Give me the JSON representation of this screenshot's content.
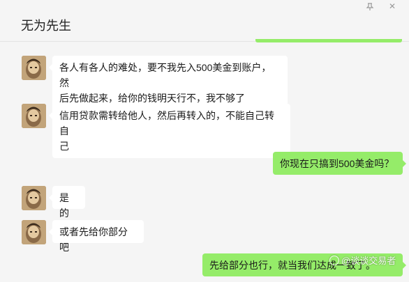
{
  "header": {
    "title": "无为先生"
  },
  "messages": [
    {
      "side": "left",
      "text": "各人有各人的难处，要不我先入500美金到账户，然\n后先做起来，给你的钱明天行不，我不够了"
    },
    {
      "side": "left",
      "text": "信用贷款需转给他人，然后再转入的，不能自己转自\n己"
    },
    {
      "side": "right",
      "text": "你现在只搞到500美金吗？"
    },
    {
      "side": "left",
      "text": "是的"
    },
    {
      "side": "left",
      "text": "或者先给你部分吧"
    },
    {
      "side": "right",
      "text": "先给部分也行，就当我们达成一致了。"
    }
  ],
  "watermark": {
    "text": "@谈谈交易者"
  },
  "colors": {
    "sent_bubble": "#95ec69",
    "received_bubble": "#ffffff",
    "background": "#f5f5f5"
  },
  "icons": {
    "pin": "pin-icon",
    "close": "close-icon"
  }
}
